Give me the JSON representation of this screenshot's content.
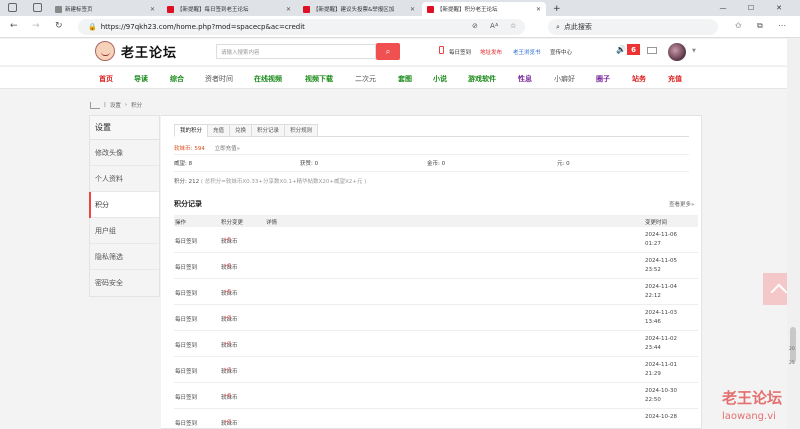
{
  "browser": {
    "tabs": [
      {
        "title": "新建标签页",
        "active": false
      },
      {
        "title": "【新提醒】每日签到老王论坛",
        "active": false
      },
      {
        "title": "【新提醒】建议头投票&举报区加",
        "active": false
      },
      {
        "title": "【新提醒】积分老王论坛",
        "active": true
      }
    ],
    "url": "https://97qkh23.com/home.php?mod=spacecp&ac=credit",
    "search_placeholder": "点此搜索"
  },
  "site": {
    "logo_text": "老王论坛",
    "search_placeholder": "请输入搜索内容",
    "header_links": {
      "checkin": "每日签到",
      "new_address": "地址发布",
      "app": "老王浏览书",
      "message_center": "宣传中心"
    },
    "notification_count": "6",
    "colors": {
      "accent": "#f05050",
      "green": "#1a8a1a",
      "red": "#e02020",
      "purple": "#7a2a9a"
    },
    "nav": [
      {
        "label": "首页",
        "color": "#e02020",
        "bold": true
      },
      {
        "label": "导读",
        "color": "#1a8a1a",
        "bold": true
      },
      {
        "label": "综合",
        "color": "#1a8a1a",
        "bold": true
      },
      {
        "label": "资者时间",
        "color": "#555555",
        "bold": false
      },
      {
        "label": "在线视频",
        "color": "#1a8a1a",
        "bold": true
      },
      {
        "label": "视频下载",
        "color": "#1a8a1a",
        "bold": true
      },
      {
        "label": "二次元",
        "color": "#555555",
        "bold": false
      },
      {
        "label": "套图",
        "color": "#1a8a1a",
        "bold": true
      },
      {
        "label": "小说",
        "color": "#1a8a1a",
        "bold": true
      },
      {
        "label": "游戏软件",
        "color": "#1a8a1a",
        "bold": true
      },
      {
        "label": "性息",
        "color": "#7a2a9a",
        "bold": true
      },
      {
        "label": "小癖好",
        "color": "#555555",
        "bold": false
      },
      {
        "label": "圈子",
        "color": "#7a2a9a",
        "bold": true
      },
      {
        "label": "站务",
        "color": "#e02020",
        "bold": true
      },
      {
        "label": "充值",
        "color": "#e02020",
        "bold": true
      }
    ]
  },
  "breadcrumb": [
    "设置",
    "积分"
  ],
  "sidebar": {
    "title": "设置",
    "items": [
      {
        "label": "修改头像",
        "active": false
      },
      {
        "label": "个人资料",
        "active": false
      },
      {
        "label": "积分",
        "active": true
      },
      {
        "label": "用户组",
        "active": false
      },
      {
        "label": "隐私筛选",
        "active": false
      },
      {
        "label": "密码安全",
        "active": false
      }
    ]
  },
  "main": {
    "tabs": [
      {
        "label": "我的积分",
        "active": true
      },
      {
        "label": "充值",
        "active": false
      },
      {
        "label": "兑换",
        "active": false
      },
      {
        "label": "积分记录",
        "active": false
      },
      {
        "label": "积分规则",
        "active": false
      }
    ],
    "softcoin_label": "软妹币:",
    "softcoin_value": "594",
    "recharge_link": "立即充值»",
    "stats": [
      {
        "label": "威望:",
        "value": "8"
      },
      {
        "label": "获赞:",
        "value": "0"
      },
      {
        "label": "金币:",
        "value": "0"
      },
      {
        "label": "元:",
        "value": "0"
      }
    ],
    "formula_label": "积分: 212",
    "formula_detail": "( 总积分=软妹币X0.33+分享数X0.1+精华帖数X20+威望X2+元 )",
    "records_title": "积分记录",
    "more_link": "查看更多»",
    "table_headers": [
      "操作",
      "积分变更",
      "详情",
      "变更时间"
    ],
    "rows": [
      {
        "op": "每日签到",
        "coin": "软妹币",
        "amount": "+5",
        "date": "2024-11-06",
        "time": "01:27"
      },
      {
        "op": "每日签到",
        "coin": "软妹币",
        "amount": "+6",
        "date": "2024-11-05",
        "time": "23:52"
      },
      {
        "op": "每日签到",
        "coin": "软妹币",
        "amount": "+5",
        "date": "2024-11-04",
        "time": "22:12"
      },
      {
        "op": "每日签到",
        "coin": "软妹币",
        "amount": "+3",
        "date": "2024-11-03",
        "time": "13:46"
      },
      {
        "op": "每日签到",
        "coin": "软妹币",
        "amount": "+3",
        "date": "2024-11-02",
        "time": "23:44"
      },
      {
        "op": "每日签到",
        "coin": "软妹币",
        "amount": "+3",
        "date": "2024-11-01",
        "time": "21:29"
      },
      {
        "op": "每日签到",
        "coin": "软妹币",
        "amount": "+6",
        "date": "2024-10-30",
        "time": "22:50"
      },
      {
        "op": "每日签到",
        "coin": "软妹币",
        "amount": "+3",
        "date": "2024-10-28",
        "time": ""
      }
    ]
  },
  "watermark": {
    "line1": "老王论坛",
    "line2": "laowang.vi"
  },
  "scroll_marks": [
    "20",
    "25"
  ]
}
